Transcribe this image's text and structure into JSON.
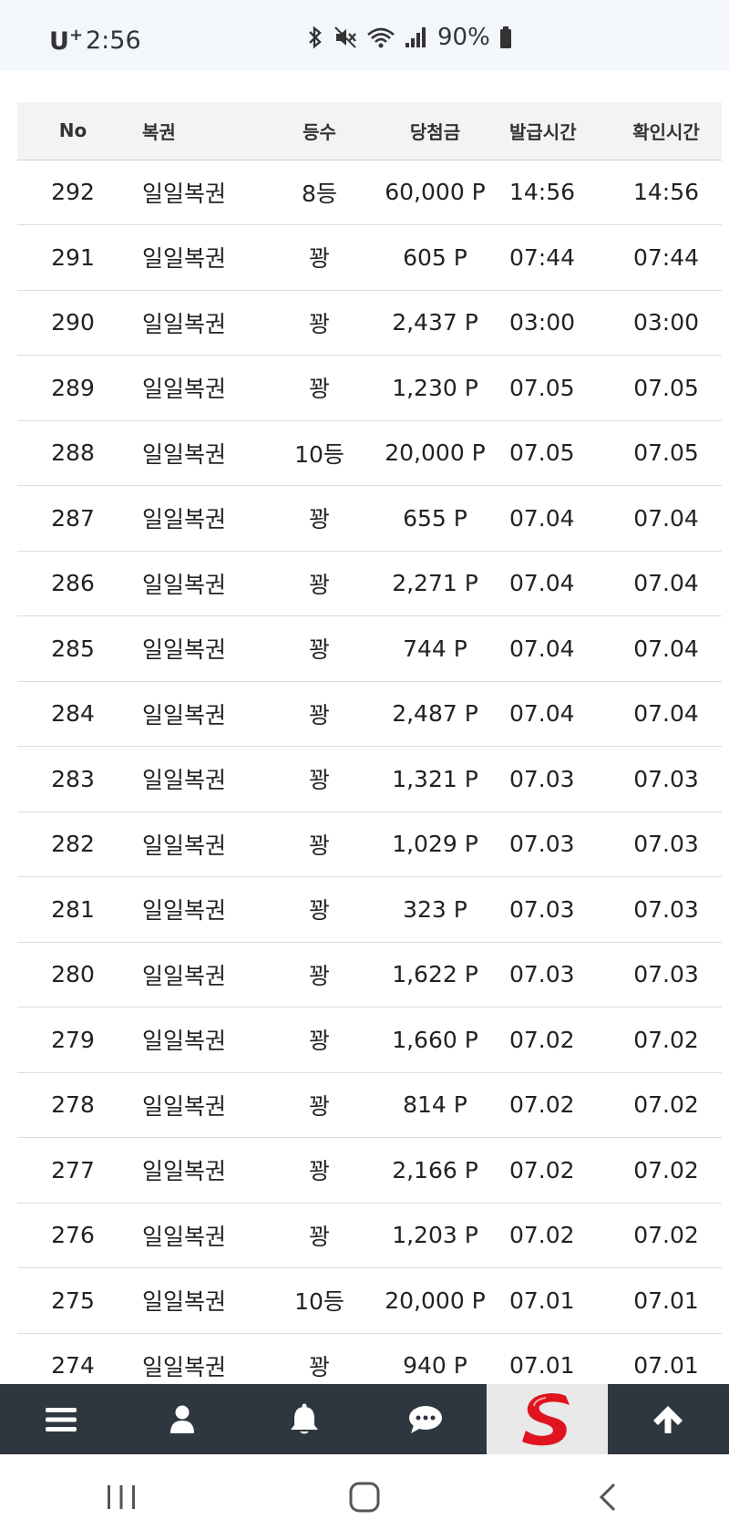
{
  "status_bar": {
    "carrier": "U",
    "carrier_plus": "+",
    "time": "2:56",
    "battery": "90%"
  },
  "table": {
    "headers": {
      "no": "No",
      "lottery": "복권",
      "rank": "등수",
      "prize": "당첨금",
      "issued": "발급시간",
      "checked": "확인시간"
    },
    "rows": [
      {
        "no": "292",
        "lottery": "일일복권",
        "rank": "8등",
        "prize": "60,000 P",
        "issued": "14:56",
        "checked": "14:56"
      },
      {
        "no": "291",
        "lottery": "일일복권",
        "rank": "꽝",
        "prize": "605 P",
        "issued": "07:44",
        "checked": "07:44"
      },
      {
        "no": "290",
        "lottery": "일일복권",
        "rank": "꽝",
        "prize": "2,437 P",
        "issued": "03:00",
        "checked": "03:00"
      },
      {
        "no": "289",
        "lottery": "일일복권",
        "rank": "꽝",
        "prize": "1,230 P",
        "issued": "07.05",
        "checked": "07.05"
      },
      {
        "no": "288",
        "lottery": "일일복권",
        "rank": "10등",
        "prize": "20,000 P",
        "issued": "07.05",
        "checked": "07.05"
      },
      {
        "no": "287",
        "lottery": "일일복권",
        "rank": "꽝",
        "prize": "655 P",
        "issued": "07.04",
        "checked": "07.04"
      },
      {
        "no": "286",
        "lottery": "일일복권",
        "rank": "꽝",
        "prize": "2,271 P",
        "issued": "07.04",
        "checked": "07.04"
      },
      {
        "no": "285",
        "lottery": "일일복권",
        "rank": "꽝",
        "prize": "744 P",
        "issued": "07.04",
        "checked": "07.04"
      },
      {
        "no": "284",
        "lottery": "일일복권",
        "rank": "꽝",
        "prize": "2,487 P",
        "issued": "07.04",
        "checked": "07.04"
      },
      {
        "no": "283",
        "lottery": "일일복권",
        "rank": "꽝",
        "prize": "1,321 P",
        "issued": "07.03",
        "checked": "07.03"
      },
      {
        "no": "282",
        "lottery": "일일복권",
        "rank": "꽝",
        "prize": "1,029 P",
        "issued": "07.03",
        "checked": "07.03"
      },
      {
        "no": "281",
        "lottery": "일일복권",
        "rank": "꽝",
        "prize": "323 P",
        "issued": "07.03",
        "checked": "07.03"
      },
      {
        "no": "280",
        "lottery": "일일복권",
        "rank": "꽝",
        "prize": "1,622 P",
        "issued": "07.03",
        "checked": "07.03"
      },
      {
        "no": "279",
        "lottery": "일일복권",
        "rank": "꽝",
        "prize": "1,660 P",
        "issued": "07.02",
        "checked": "07.02"
      },
      {
        "no": "278",
        "lottery": "일일복권",
        "rank": "꽝",
        "prize": "814 P",
        "issued": "07.02",
        "checked": "07.02"
      },
      {
        "no": "277",
        "lottery": "일일복권",
        "rank": "꽝",
        "prize": "2,166 P",
        "issued": "07.02",
        "checked": "07.02"
      },
      {
        "no": "276",
        "lottery": "일일복권",
        "rank": "꽝",
        "prize": "1,203 P",
        "issued": "07.02",
        "checked": "07.02"
      },
      {
        "no": "275",
        "lottery": "일일복권",
        "rank": "10등",
        "prize": "20,000 P",
        "issued": "07.01",
        "checked": "07.01"
      },
      {
        "no": "274",
        "lottery": "일일복권",
        "rank": "꽝",
        "prize": "940 P",
        "issued": "07.01",
        "checked": "07.01"
      }
    ]
  },
  "bottom_nav": {
    "items": [
      {
        "icon": "menu-icon"
      },
      {
        "icon": "user-icon"
      },
      {
        "icon": "bell-icon"
      },
      {
        "icon": "chat-icon"
      },
      {
        "icon": "site-logo"
      },
      {
        "icon": "arrow-up-icon"
      }
    ],
    "background": "#2e3640",
    "logo_color": "#e0141e"
  },
  "system_nav": {
    "items": [
      {
        "icon": "recent-apps-icon"
      },
      {
        "icon": "home-icon"
      },
      {
        "icon": "back-icon"
      }
    ]
  }
}
